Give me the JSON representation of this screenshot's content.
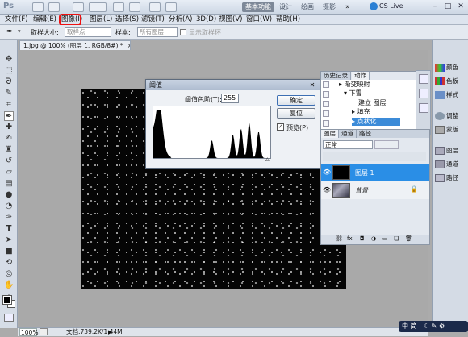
{
  "appbar": {
    "logo": "Ps",
    "workspaces": [
      "基本功能",
      "设计",
      "绘画",
      "摄影"
    ],
    "cs_live": "CS Live"
  },
  "menubar": {
    "items": [
      "文件(F)",
      "编辑(E)",
      "图像(I)",
      "图层(L)",
      "选择(S)",
      "滤镜(T)",
      "分析(A)",
      "3D(D)",
      "视图(V)",
      "窗口(W)",
      "帮助(H)"
    ]
  },
  "optionsbar": {
    "sample_size_label": "取样大小:",
    "sample_size_value": "取样点",
    "sample_label": "样本:",
    "sample_value": "所有图层",
    "show_ring_label": "显示取样环"
  },
  "document": {
    "tab_title": "1.jpg @ 100% (图层 1, RGB/8#) *"
  },
  "statusbar": {
    "zoom": "100%",
    "doc_info": "文档:739.2K/1.44M"
  },
  "threshold_dialog": {
    "title": "阈值",
    "level_label": "阈值色阶(T):",
    "level_value": "255",
    "ok_label": "确定",
    "reset_label": "复位",
    "preview_label": "预览(P)",
    "preview_checked": true
  },
  "history_panel": {
    "tabs": [
      "历史记录",
      "动作"
    ],
    "actions": [
      "渐变映射",
      "下雪",
      "建立 图层",
      "填充",
      "点状化"
    ],
    "selected_action": "点状化"
  },
  "layers_panel": {
    "tabs": [
      "图层",
      "通道",
      "路径"
    ],
    "blend_mode": "正常",
    "layers": [
      {
        "name": "图层 1",
        "selected": true
      },
      {
        "name": "背景",
        "selected": false
      }
    ]
  },
  "dock": {
    "group1": [
      "颜色",
      "色板",
      "样式"
    ],
    "group2": [
      "调整",
      "蒙版"
    ],
    "group3": [
      "图层",
      "通道",
      "路径"
    ]
  },
  "ime": {
    "label": "中 简"
  },
  "histogram": {
    "peaks": [
      0.05,
      0.5,
      0.68,
      0.75,
      0.82,
      0.9
    ],
    "threshold": 255
  }
}
